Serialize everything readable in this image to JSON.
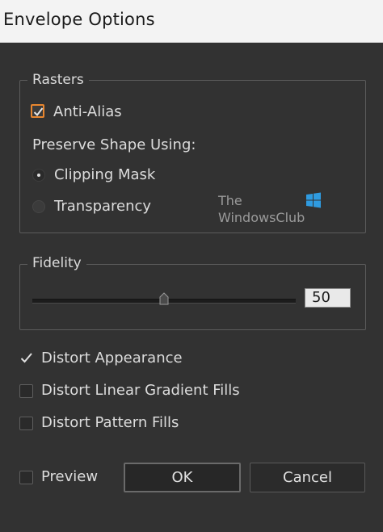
{
  "window": {
    "title": "Envelope Options"
  },
  "rasters": {
    "group_label": "Rasters",
    "anti_alias": {
      "label": "Anti-Alias",
      "checked": true
    },
    "preserve_label": "Preserve Shape Using:",
    "options": [
      {
        "label": "Clipping Mask",
        "selected": true
      },
      {
        "label": "Transparency",
        "selected": false
      }
    ]
  },
  "fidelity": {
    "group_label": "Fidelity",
    "value": "50"
  },
  "checks": [
    {
      "label": "Distort Appearance",
      "checked": true
    },
    {
      "label": "Distort Linear Gradient Fills",
      "checked": false
    },
    {
      "label": "Distort Pattern Fills",
      "checked": false
    }
  ],
  "footer": {
    "preview_label": "Preview",
    "preview_checked": false,
    "ok_label": "OK",
    "cancel_label": "Cancel"
  },
  "watermark": {
    "line1": "The",
    "line2": "WindowsClub"
  },
  "colors": {
    "accent": "#e8862f",
    "background": "#323232"
  }
}
